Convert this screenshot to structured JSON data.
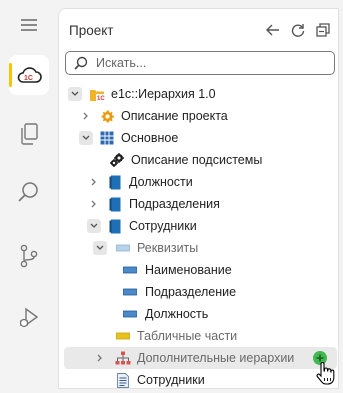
{
  "activity_bar": {
    "items": [
      {
        "name": "1c-logo-icon",
        "active": true
      },
      {
        "name": "files-icon"
      },
      {
        "name": "search-icon"
      },
      {
        "name": "source-control-icon"
      },
      {
        "name": "run-debug-icon"
      }
    ],
    "menu_icon": "hamburger-icon",
    "accent": "#f2c800"
  },
  "panel": {
    "title": "Проект",
    "actions": [
      "back-arrow-icon",
      "refresh-icon",
      "collapse-all-icon"
    ]
  },
  "search": {
    "placeholder": "Искать..."
  },
  "tree": {
    "root": "e1c::Иерархия 1.0",
    "project_description": "Описание проекта",
    "main": "Основное",
    "subsystem_description": "Описание подсистемы",
    "positions": "Должности",
    "departments": "Подразделения",
    "employees": "Сотрудники",
    "attributes": "Реквизиты",
    "attr_name": "Наименование",
    "attr_department": "Подразделение",
    "attr_position": "Должность",
    "tabular_parts": "Табличные части",
    "additional_hierarchies": "Дополнительные иерархии",
    "employees_doc": "Сотрудники"
  },
  "colors": {
    "catalog_blue": "#1f6fb5",
    "attribute_blue": "#4d89c9",
    "tabular_yellow": "#e8c21a",
    "add_green": "#3fb950",
    "hierarchy_red": "#d9534f"
  }
}
